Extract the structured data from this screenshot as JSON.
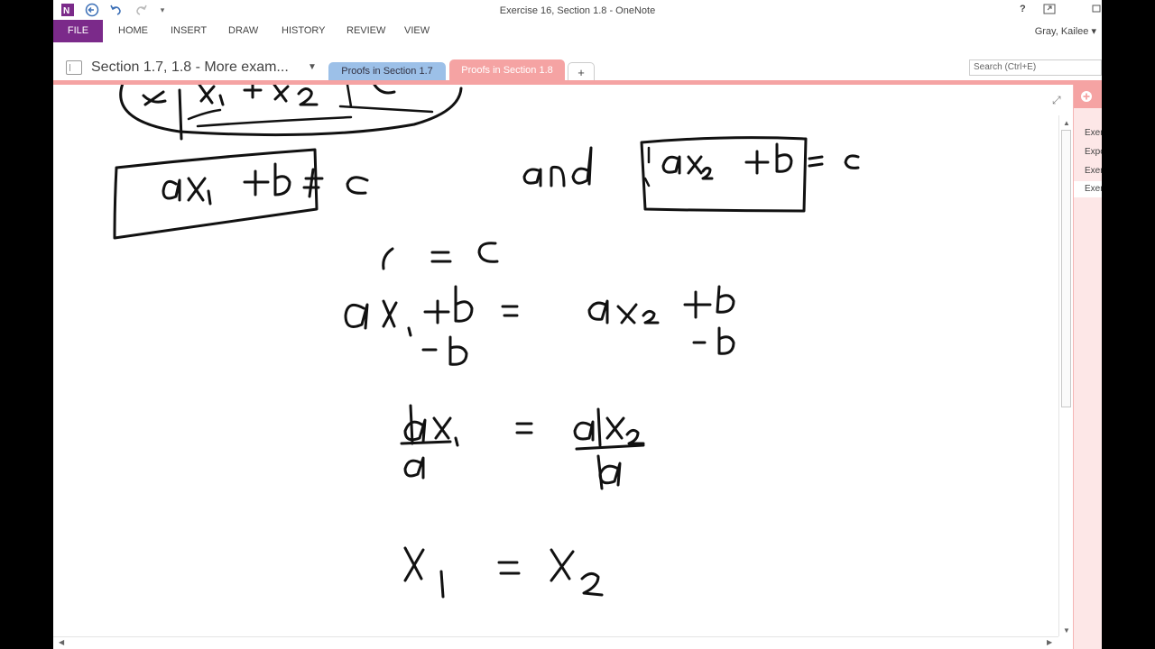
{
  "window": {
    "title": "Exercise 16, Section 1.8 - OneNote",
    "help": "?",
    "user": "Gray, Kailee"
  },
  "ribbon": {
    "tabs": [
      "FILE",
      "HOME",
      "INSERT",
      "DRAW",
      "HISTORY",
      "REVIEW",
      "VIEW"
    ]
  },
  "notebook": {
    "section_title": "Section 1.7, 1.8 - More exam...",
    "page_tabs": [
      "Proofs in Section 1.7",
      "Proofs in Section 1.8",
      "+"
    ],
    "active_tab": "Proofs in Section 1.8",
    "search_placeholder": "Search (Ctrl+E)"
  },
  "pages_pane": {
    "add_symbol": "+",
    "items": [
      "Exer",
      "Expo",
      "Exer",
      "Exer"
    ]
  },
  "colors": {
    "file_tab": "#7b2a8a",
    "section_tab_active": "#f5a3a3",
    "section_tab_inactive": "#9cc0e8",
    "ink": "#000000"
  },
  "icons": [
    "onenote-logo-icon",
    "back-icon",
    "undo-icon",
    "redo-icon",
    "customize-toolbar-icon",
    "help-icon",
    "restore-icon",
    "expand-page-icon",
    "add-page-icon"
  ],
  "ink": {
    "top_strip": "x₁ + x₂",
    "line1_left": "ax₁ + b = c",
    "line1_and": "and",
    "line1_right": "ax₂ + b = c",
    "line2": "c = c",
    "line3": "ax₁ + b = ax₂ + b",
    "line3_sub_left": "-b",
    "line3_sub_right": "-b",
    "line4": "ax₁/a = ax₂/a",
    "line5": "x₁ = x₂"
  }
}
